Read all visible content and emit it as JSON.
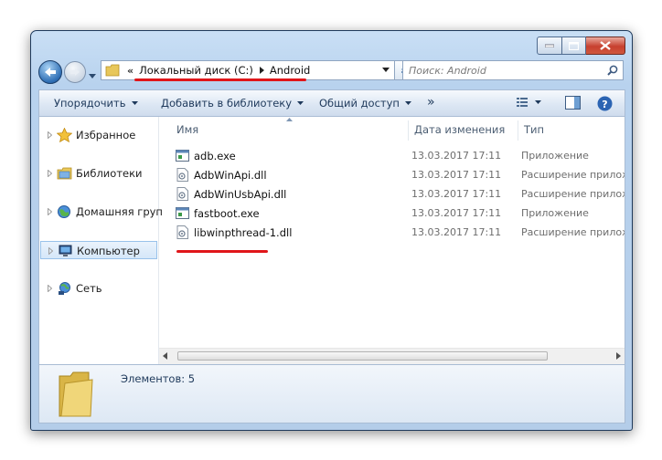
{
  "window": {
    "controls": {
      "minimize": "minimize",
      "maximize": "maximize",
      "close": "close"
    }
  },
  "address": {
    "overflow": "«",
    "crumbs": [
      "Локальный диск (C:)",
      "Android"
    ]
  },
  "search": {
    "placeholder": "Поиск: Android"
  },
  "toolbar": {
    "organize": "Упорядочить",
    "add_to_library": "Добавить в библиотеку",
    "share": "Общий доступ",
    "more": "»"
  },
  "nav": {
    "items": [
      {
        "label": "Избранное",
        "icon": "star-icon"
      },
      {
        "label": "Библиотеки",
        "icon": "libraries-icon"
      },
      {
        "label": "Домашняя груп",
        "icon": "homegroup-icon"
      },
      {
        "label": "Компьютер",
        "icon": "computer-icon",
        "selected": true
      },
      {
        "label": "Сеть",
        "icon": "network-icon"
      }
    ]
  },
  "columns": {
    "name": "Имя",
    "date": "Дата изменения",
    "type": "Тип"
  },
  "files": [
    {
      "name": "adb.exe",
      "date": "13.03.2017 17:11",
      "type": "Приложение",
      "icon": "exe-icon"
    },
    {
      "name": "AdbWinApi.dll",
      "date": "13.03.2017 17:11",
      "type": "Расширение приложения",
      "icon": "dll-icon"
    },
    {
      "name": "AdbWinUsbApi.dll",
      "date": "13.03.2017 17:11",
      "type": "Расширение приложения",
      "icon": "dll-icon"
    },
    {
      "name": "fastboot.exe",
      "date": "13.03.2017 17:11",
      "type": "Приложение",
      "icon": "exe-icon"
    },
    {
      "name": "libwinpthread-1.dll",
      "date": "13.03.2017 17:11",
      "type": "Расширение приложения",
      "icon": "dll-icon"
    }
  ],
  "details": {
    "count": "Элементов: 5"
  },
  "colors": {
    "highlight": "#e0161a",
    "accent": "#1e395b"
  }
}
